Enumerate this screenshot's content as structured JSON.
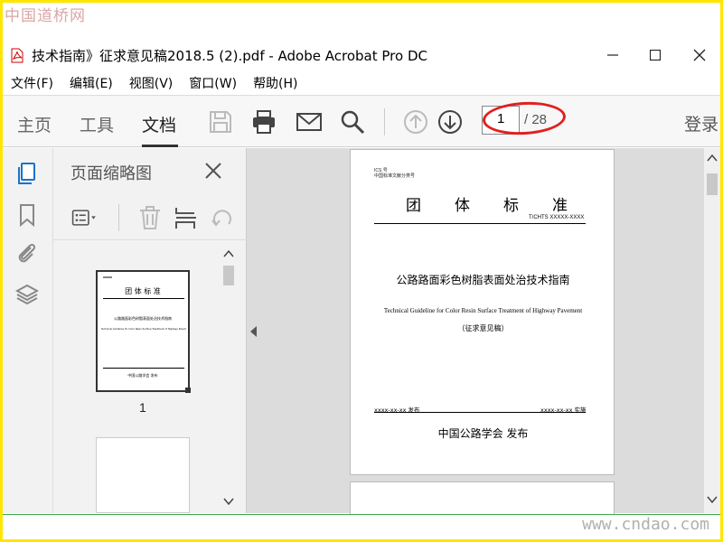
{
  "watermark": {
    "top": "中国道桥网",
    "bottom": "www.cndao.com"
  },
  "window": {
    "title": "技术指南》征求意见稿2018.5 (2).pdf - Adobe Acrobat Pro DC",
    "controls": {
      "minimize": "—",
      "maximize": "☐",
      "close": "✕"
    }
  },
  "menu": [
    "文件(F)",
    "编辑(E)",
    "视图(V)",
    "窗口(W)",
    "帮助(H)"
  ],
  "toolbar": {
    "tabs": [
      "主页",
      "工具",
      "文档"
    ],
    "active_tab": "文档",
    "page_current": "1",
    "page_total": "/ 28",
    "login": "登录"
  },
  "thumbnails_panel": {
    "title": "页面缩略图",
    "page_label": "1",
    "thumb": {
      "heading": "团 体 标 准",
      "cn_title": "公路路面彩色树脂表面处治技术指南",
      "en_title": "Technical Guideline for Color Resin Surface Treatment of Highway Pavement",
      "pub": "中国公路学会 发布"
    }
  },
  "document": {
    "ics": "ICS 号",
    "catalog": "中国标准文献分类号",
    "heading_chars": [
      "团",
      "体",
      "标",
      "准"
    ],
    "code": "T/CHTS XXXXX-XXXX",
    "cn_title": "公路路面彩色树脂表面处治技术指南",
    "en_title": "Technical Guideline for Color Resin Surface Treatment of Highway Pavement",
    "draft": "（征求意见稿）",
    "date_issue": "xxxx-xx-xx 发布",
    "date_impl": "xxxx-xx-xx 实施",
    "publisher": "中国公路学会 发布"
  }
}
